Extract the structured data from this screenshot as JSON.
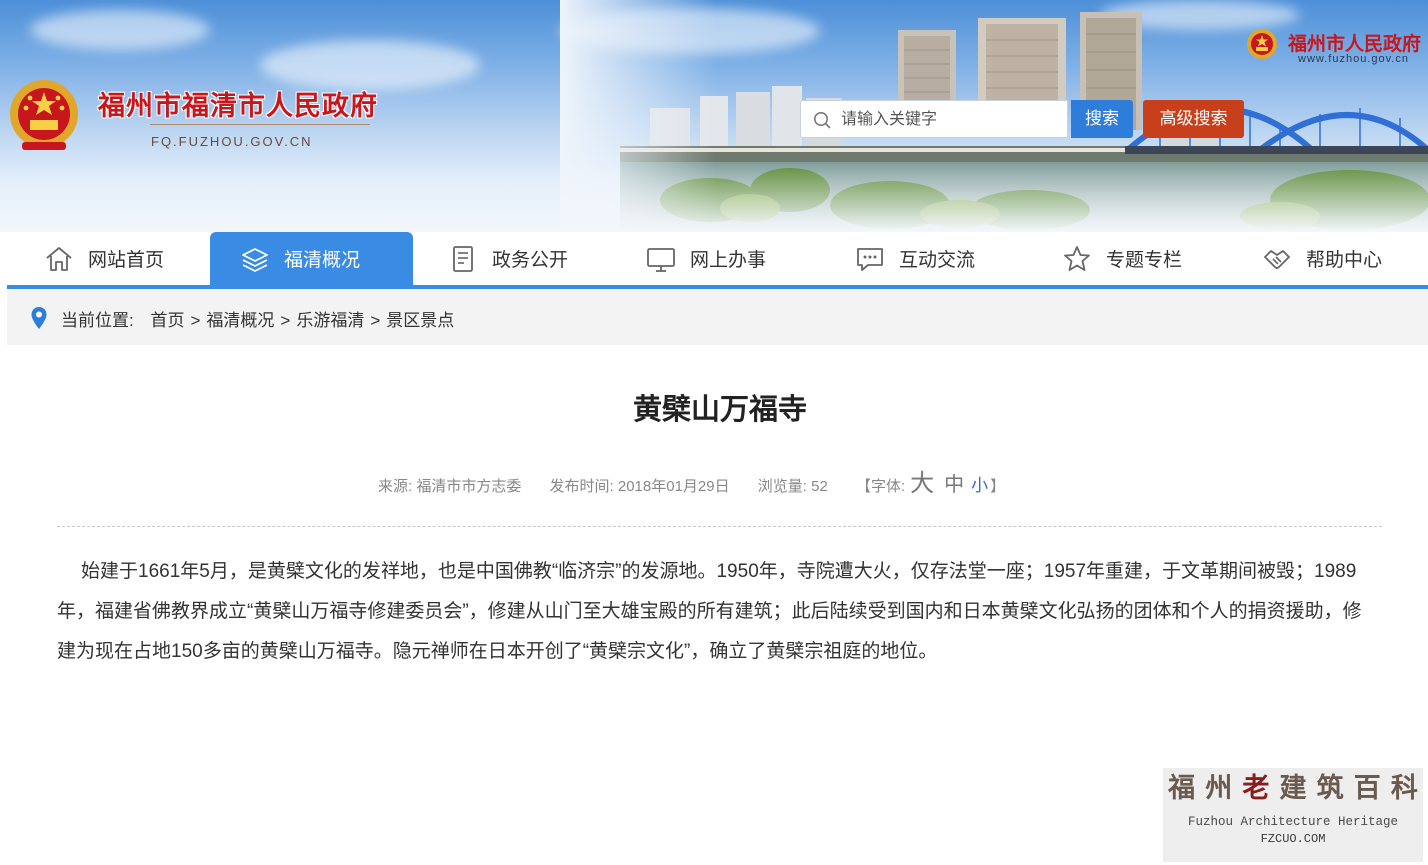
{
  "header": {
    "site_name": "福州市福清市人民政府",
    "site_domain": "FQ.FUZHOU.GOV.CN",
    "top_site_name": "福州市人民政府",
    "top_site_domain": "www.fuzhou.gov.cn",
    "search": {
      "placeholder": "请输入关键字",
      "button_label": "搜索"
    },
    "advanced_search_label": "高级搜索"
  },
  "nav": {
    "items": [
      {
        "label": "网站首页",
        "icon": "home-icon"
      },
      {
        "label": "福清概况",
        "icon": "layers-icon",
        "active": true
      },
      {
        "label": "政务公开",
        "icon": "document-icon"
      },
      {
        "label": "网上办事",
        "icon": "monitor-icon"
      },
      {
        "label": "互动交流",
        "icon": "chat-bubble-icon"
      },
      {
        "label": "专题专栏",
        "icon": "star-icon"
      },
      {
        "label": "帮助中心",
        "icon": "handshake-icon"
      }
    ],
    "active_color": "#3a8be4"
  },
  "breadcrumb": {
    "prefix": "当前位置:",
    "items": [
      "首页",
      "福清概况",
      "乐游福清",
      "景区景点"
    ],
    "separator": ">"
  },
  "article": {
    "title": "黄檗山万福寺",
    "source": "来源: 福清市市方志委",
    "publish_time": "发布时间: 2018年01月29日",
    "views": "浏览量: 52",
    "font_size": {
      "open": "【字体:",
      "large": "大",
      "medium": "中",
      "small": "小",
      "close": "】"
    },
    "body": "始建于1661年5月，是黄檗文化的发祥地，也是中国佛教“临济宗”的发源地。1950年，寺院遭大火，仅存法堂一座；1957年重建，于文革期间被毁；1989年，福建省佛教界成立“黄檗山万福寺修建委员会”，修建从山门至大雄宝殿的所有建筑；此后陆续受到国内和日本黄檗文化弘扬的团体和个人的捐资援助，修建为现在占地150多亩的黄檗山万福寺。隐元禅师在日本开创了“黄檗宗文化”，确立了黄檗宗祖庭的地位。"
  },
  "watermark": {
    "chars": [
      "福",
      "州",
      "老",
      "建",
      "筑",
      "百",
      "科"
    ],
    "english": "Fuzhou Architecture Heritage",
    "url": "FZCUO.COM"
  },
  "colors": {
    "brand_red": "#c8161d",
    "search_blue": "#2f7ddb",
    "advanced_orange": "#c8401b",
    "nav_blue": "#3a8be4"
  }
}
